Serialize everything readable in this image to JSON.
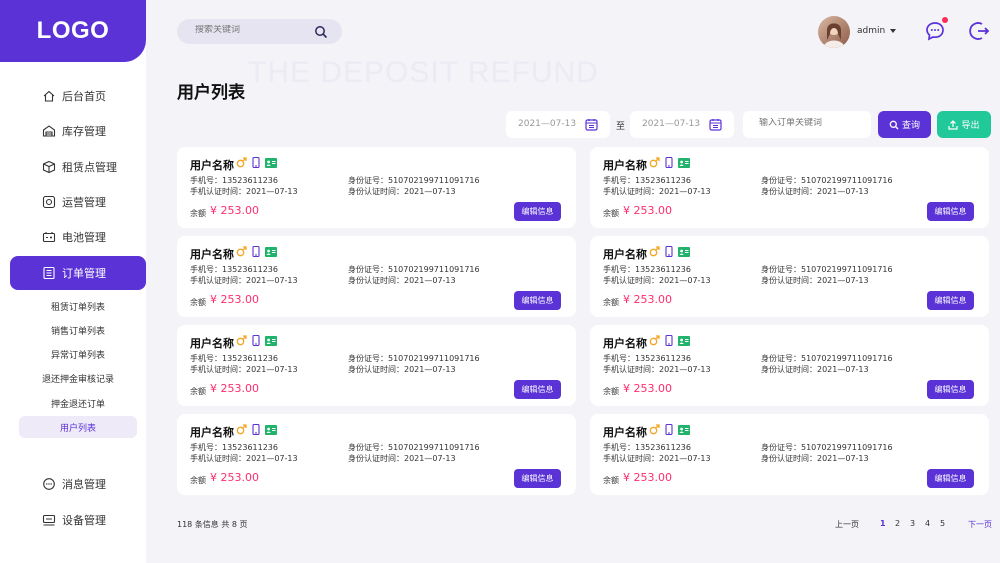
{
  "brand": {
    "logo": "LOGO"
  },
  "sidebar": {
    "items": [
      {
        "label": "后台首页",
        "icon": "home-icon"
      },
      {
        "label": "库存管理",
        "icon": "warehouse-icon"
      },
      {
        "label": "租赁点管理",
        "icon": "box-icon"
      },
      {
        "label": "运营管理",
        "icon": "chart-icon"
      },
      {
        "label": "电池管理",
        "icon": "battery-icon"
      },
      {
        "label": "订单管理",
        "icon": "order-icon"
      },
      {
        "label": "消息管理",
        "icon": "message-icon"
      },
      {
        "label": "设备管理",
        "icon": "device-icon"
      }
    ],
    "subitems": [
      "租赁订单列表",
      "销售订单列表",
      "异常订单列表",
      "退还押金审核记录",
      "押金退还订单",
      "用户列表"
    ]
  },
  "header": {
    "search_placeholder": "搜索关键词",
    "username": "admin",
    "bg_title": "THE DEPOSIT REFUND",
    "page_title": "用户列表"
  },
  "filters": {
    "date_start": "2021—07-13",
    "date_end": "2021—07-13",
    "to_label": "至",
    "order_placeholder": "输入订单关键词",
    "query_label": "查询",
    "export_label": "导出"
  },
  "card": {
    "name": "用户名称",
    "phone": "手机号：13523611236",
    "phone_time": "手机认证时间：2021—07-13",
    "id": "身份证号：510702199711091716",
    "id_time": "身份认证时间：2021—07-13",
    "balance_label": "余额",
    "balance": "¥ 253.00",
    "edit_label": "编辑信息"
  },
  "pagination": {
    "total": "118 条信息 共 8 页",
    "prev": "上一页",
    "pages": [
      "1",
      "2",
      "3",
      "4",
      "5"
    ],
    "next": "下一页"
  },
  "colors": {
    "accent": "#5a32d6",
    "success": "#21c89a",
    "price": "#ff2d6e",
    "notify": "#ff2d55"
  }
}
